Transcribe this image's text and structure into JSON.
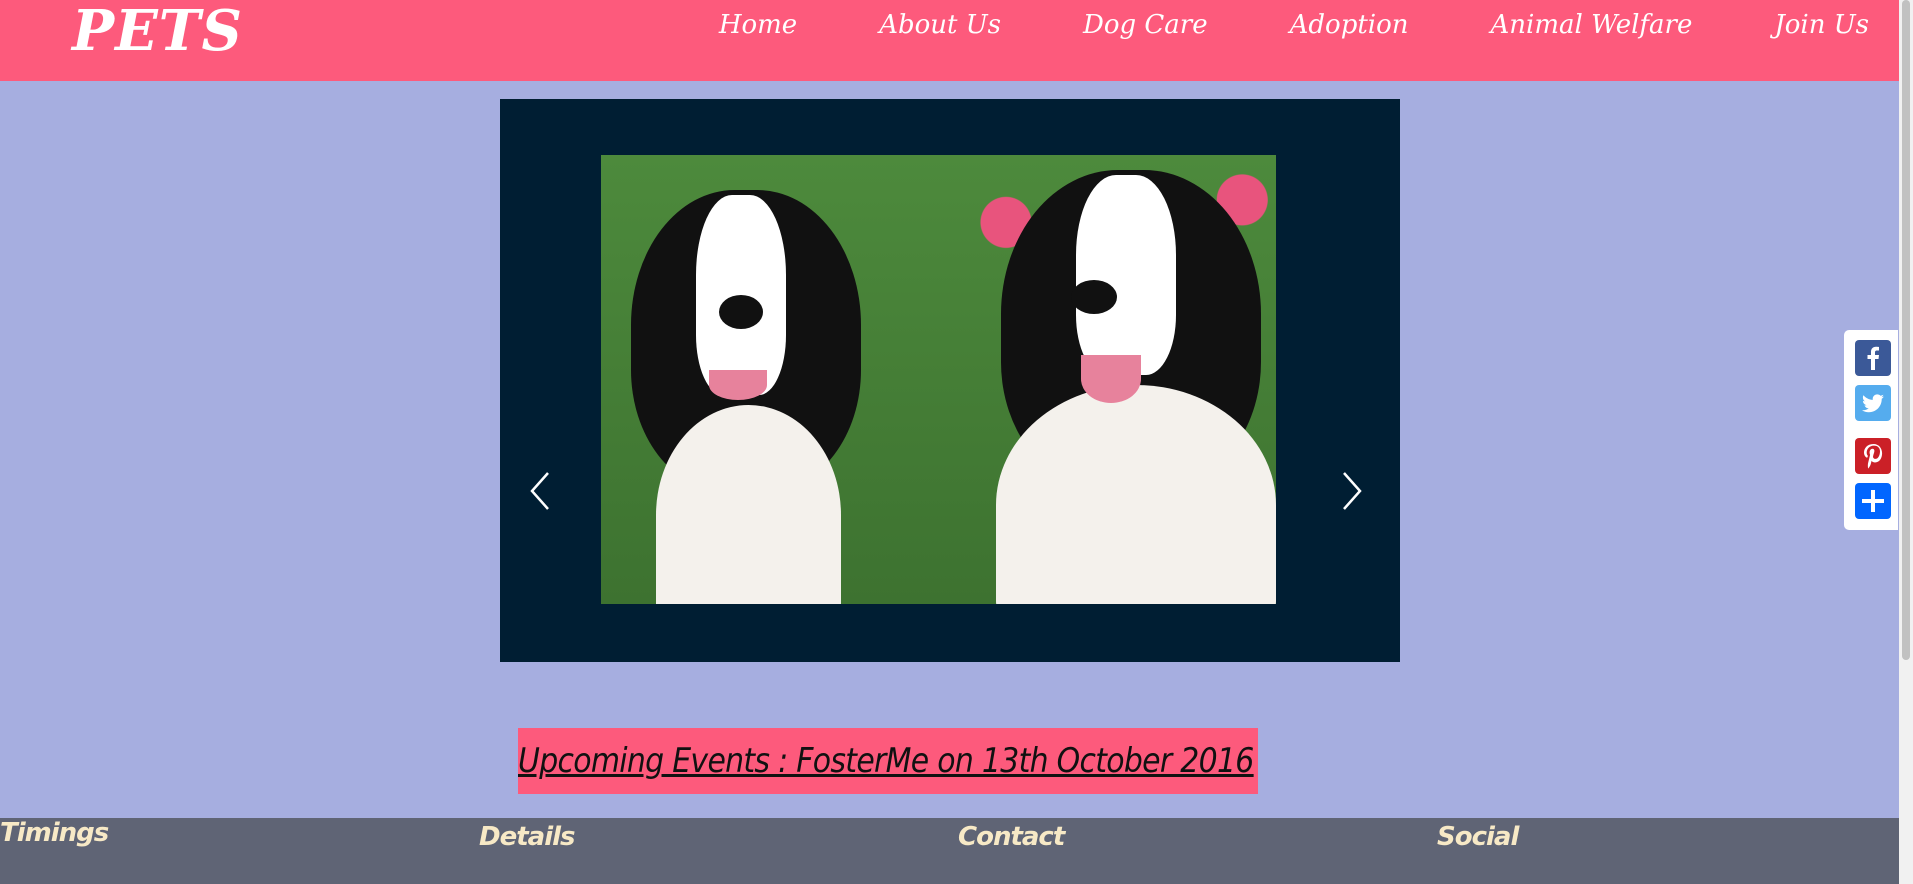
{
  "header": {
    "logo": "PETS",
    "nav": [
      "Home",
      "About Us",
      "Dog Care",
      "Adoption",
      "Animal Welfare",
      "Join Us"
    ]
  },
  "carousel": {
    "prev_icon": "chevron-left-icon",
    "next_icon": "chevron-right-icon"
  },
  "events": {
    "text": "Upcoming Events : FosterMe on 13th October 2016"
  },
  "footer": {
    "columns": [
      "Timings",
      "Details",
      "Contact",
      "Social"
    ]
  },
  "share": {
    "icons": [
      "facebook-icon",
      "twitter-icon",
      "pinterest-icon",
      "share-plus-icon"
    ],
    "colors": [
      "#3b5998",
      "#55acee",
      "#cb2027",
      "#0166ff"
    ]
  },
  "colors": {
    "nav_bg": "#fd5a7c",
    "page_bg": "#a6aee0",
    "carousel_bg": "#001e33",
    "footer_bg": "#5f6475",
    "footer_text": "#f7e9c6"
  }
}
